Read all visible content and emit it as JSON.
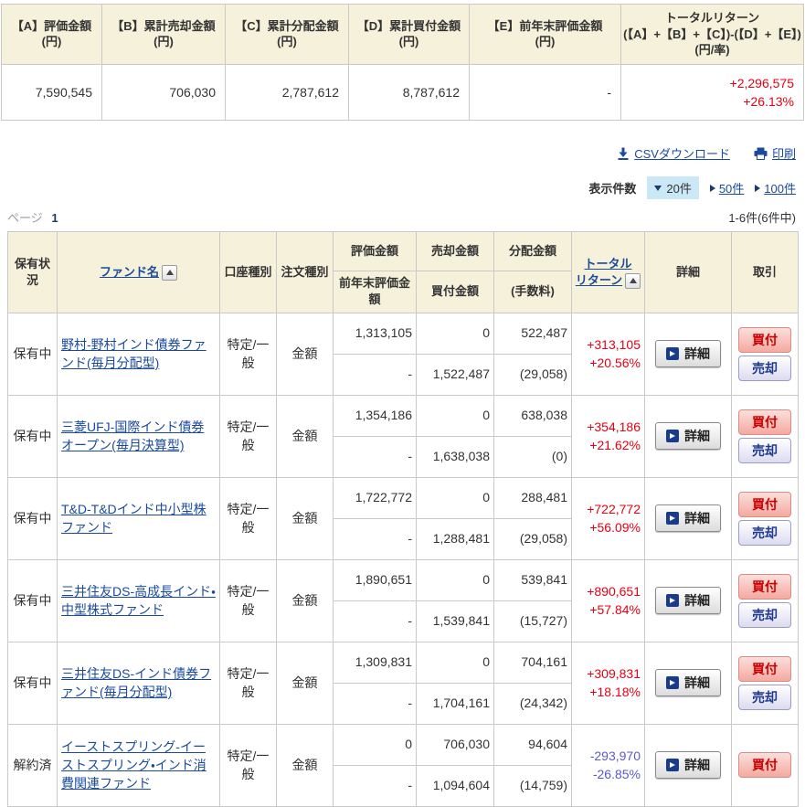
{
  "summary": {
    "columns": [
      {
        "label": "【A】評価金額",
        "unit": "(円)",
        "value": "7,590,545"
      },
      {
        "label": "【B】累計売却金額",
        "unit": "(円)",
        "value": "706,030"
      },
      {
        "label": "【C】累計分配金額",
        "unit": "(円)",
        "value": "2,787,612"
      },
      {
        "label": "【D】累計買付金額",
        "unit": "(円)",
        "value": "8,787,612"
      },
      {
        "label": "【E】前年末評価金額",
        "unit": "(円)",
        "value": "-"
      },
      {
        "label": "トータルリターン",
        "formula": "(【A】+【B】+【C】)-(【D】+【E】)",
        "unit": "(円/率)",
        "value": "+2,296,575",
        "value2": "+26.13%"
      }
    ]
  },
  "toolbar": {
    "csv_label": "CSVダウンロード",
    "print_label": "印刷"
  },
  "display_count": {
    "label": "表示件数",
    "selected": "20件",
    "option2": "50件",
    "option3": "100件"
  },
  "pagination": {
    "page_label": "ページ",
    "current_page": "1",
    "range_text": "1-6件(6件中)"
  },
  "table": {
    "headers": {
      "status": "保有状況",
      "fund_name": "ファンド名",
      "account_type": "口座種別",
      "order_type": "注文種別",
      "valuation": "評価金額",
      "prev_year_valuation": "前年末評価金額",
      "sell_amount": "売却金額",
      "buy_amount": "買付金額",
      "distribution": "分配金額",
      "fee": "(手数料)",
      "total_return_1": "トータル",
      "total_return_2": "リターン",
      "detail": "詳細",
      "trade": "取引"
    },
    "buttons": {
      "detail": "詳細",
      "buy": "買付",
      "sell": "売却"
    },
    "rows": [
      {
        "status": "保有中",
        "fund_name": "野村-野村インド債券ファンド(毎月分配型)",
        "account_type": "特定/一般",
        "order_type": "金額",
        "valuation": "1,313,105",
        "prev_year_valuation": "-",
        "sell_amount": "0",
        "buy_amount": "1,522,487",
        "distribution": "522,487",
        "fee": "(29,058)",
        "return_amount": "+313,105",
        "return_rate": "+20.56%",
        "negative": false,
        "has_sell": true
      },
      {
        "status": "保有中",
        "fund_name": "三菱UFJ-国際インド債券オープン(毎月決算型)",
        "account_type": "特定/一般",
        "order_type": "金額",
        "valuation": "1,354,186",
        "prev_year_valuation": "-",
        "sell_amount": "0",
        "buy_amount": "1,638,038",
        "distribution": "638,038",
        "fee": "(0)",
        "return_amount": "+354,186",
        "return_rate": "+21.62%",
        "negative": false,
        "has_sell": true
      },
      {
        "status": "保有中",
        "fund_name": "T&D-T&Dインド中小型株ファンド",
        "account_type": "特定/一般",
        "order_type": "金額",
        "valuation": "1,722,772",
        "prev_year_valuation": "-",
        "sell_amount": "0",
        "buy_amount": "1,288,481",
        "distribution": "288,481",
        "fee": "(29,058)",
        "return_amount": "+722,772",
        "return_rate": "+56.09%",
        "negative": false,
        "has_sell": true
      },
      {
        "status": "保有中",
        "fund_name": "三井住友DS-高成長インド・中型株式ファンド",
        "account_type": "特定/一般",
        "order_type": "金額",
        "valuation": "1,890,651",
        "prev_year_valuation": "-",
        "sell_amount": "0",
        "buy_amount": "1,539,841",
        "distribution": "539,841",
        "fee": "(15,727)",
        "return_amount": "+890,651",
        "return_rate": "+57.84%",
        "negative": false,
        "has_sell": true
      },
      {
        "status": "保有中",
        "fund_name": "三井住友DS-インド債券ファンド(毎月分配型)",
        "account_type": "特定/一般",
        "order_type": "金額",
        "valuation": "1,309,831",
        "prev_year_valuation": "-",
        "sell_amount": "0",
        "buy_amount": "1,704,161",
        "distribution": "704,161",
        "fee": "(24,342)",
        "return_amount": "+309,831",
        "return_rate": "+18.18%",
        "negative": false,
        "has_sell": true
      },
      {
        "status": "解約済",
        "fund_name": "イーストスプリング-イーストスプリング・インド消費関連ファンド",
        "account_type": "特定/一般",
        "order_type": "金額",
        "valuation": "0",
        "prev_year_valuation": "-",
        "sell_amount": "706,030",
        "buy_amount": "1,094,604",
        "distribution": "94,604",
        "fee": "(14,759)",
        "return_amount": "-293,970",
        "return_rate": "-26.85%",
        "negative": true,
        "has_sell": false
      }
    ]
  },
  "colors": {
    "positive_return": "#e60012",
    "negative_return": "#5959cc",
    "header_bg": "#f6f1da",
    "link": "#1a4a9e",
    "selected_bg": "#cbe8f6"
  }
}
